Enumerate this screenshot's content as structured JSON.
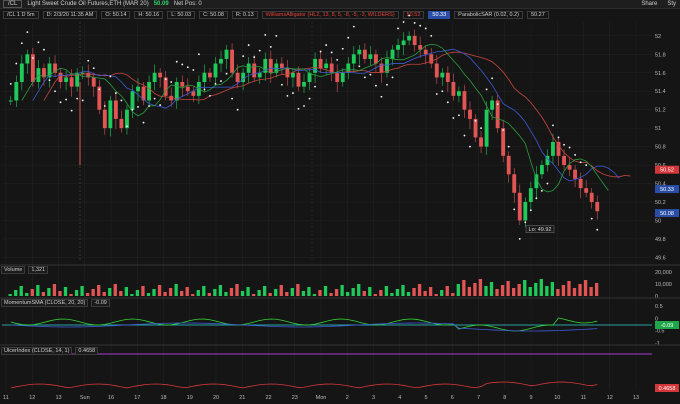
{
  "toolbar": {
    "symbol": "/CL",
    "instrument": "Light Sweet Crude Oil Futures,ETH (MAR 20)",
    "last_price": "50.09",
    "net_pos_label": "Net Pos: 0",
    "share_label": "Share",
    "style_label": "Sty"
  },
  "study_bar": {
    "chart_id": "/CL 1 D 5m",
    "items": [
      "D: 2/3/20 11:35 AM",
      "O: 50.14",
      "H: 50.16",
      "L: 50.03",
      "C: 50.08",
      "R: 0.13"
    ],
    "williams": "WilliamsAlligator (HL2, 13, 8, 5, -8, -5, -3, WILDERS)",
    "williams_value": "50.52",
    "blue_value": "50.33",
    "sar_label": "ParabolicSAR (0.02, 0.2)",
    "sar_value": "50.27"
  },
  "price_axis": [
    "52",
    "51.8",
    "51.6",
    "51.4",
    "51.2",
    "51",
    "50.8",
    "50.6",
    "50.4",
    "50.2",
    "50",
    "49.8",
    "49.6"
  ],
  "price_boxes": [
    {
      "text": "50.52",
      "color": "#d4373a"
    },
    {
      "text": "50.33",
      "color": "#2a4ea5"
    },
    {
      "text": "50.08",
      "color": "#2a4ea5"
    }
  ],
  "low_callout": "Lo: 49.92",
  "volume_panel": {
    "label": "Volume",
    "value": "1,321",
    "axis": [
      "20,000",
      "10,000",
      "0"
    ]
  },
  "momentum_panel": {
    "label": "MomentumSMA (CLOSE, 20, 20)",
    "value": "-0.09",
    "axis": [
      "0.5",
      "0",
      "-0.5",
      "-1"
    ],
    "box": "-0.09"
  },
  "ulcer_panel": {
    "label": "UlcerIndex (CLOSE, 14, 1)",
    "value": "0.4658",
    "axis": [
      "0.4658"
    ],
    "box": "0.4658"
  },
  "time_axis": [
    "11",
    "12",
    "13",
    "Sun",
    "16",
    "17",
    "18",
    "19",
    "20",
    "21",
    "22",
    "23",
    "Mon",
    "2",
    "3",
    "4",
    "5",
    "6",
    "7",
    "8",
    "9",
    "10",
    "11",
    "12",
    "13"
  ],
  "colors": {
    "up": "#1fc95a",
    "down": "#e15555",
    "alligator_blue": "#3d5bd6",
    "alligator_red": "#c8473f",
    "alligator_green": "#2a9e3e",
    "sar": "#ffffff"
  }
}
